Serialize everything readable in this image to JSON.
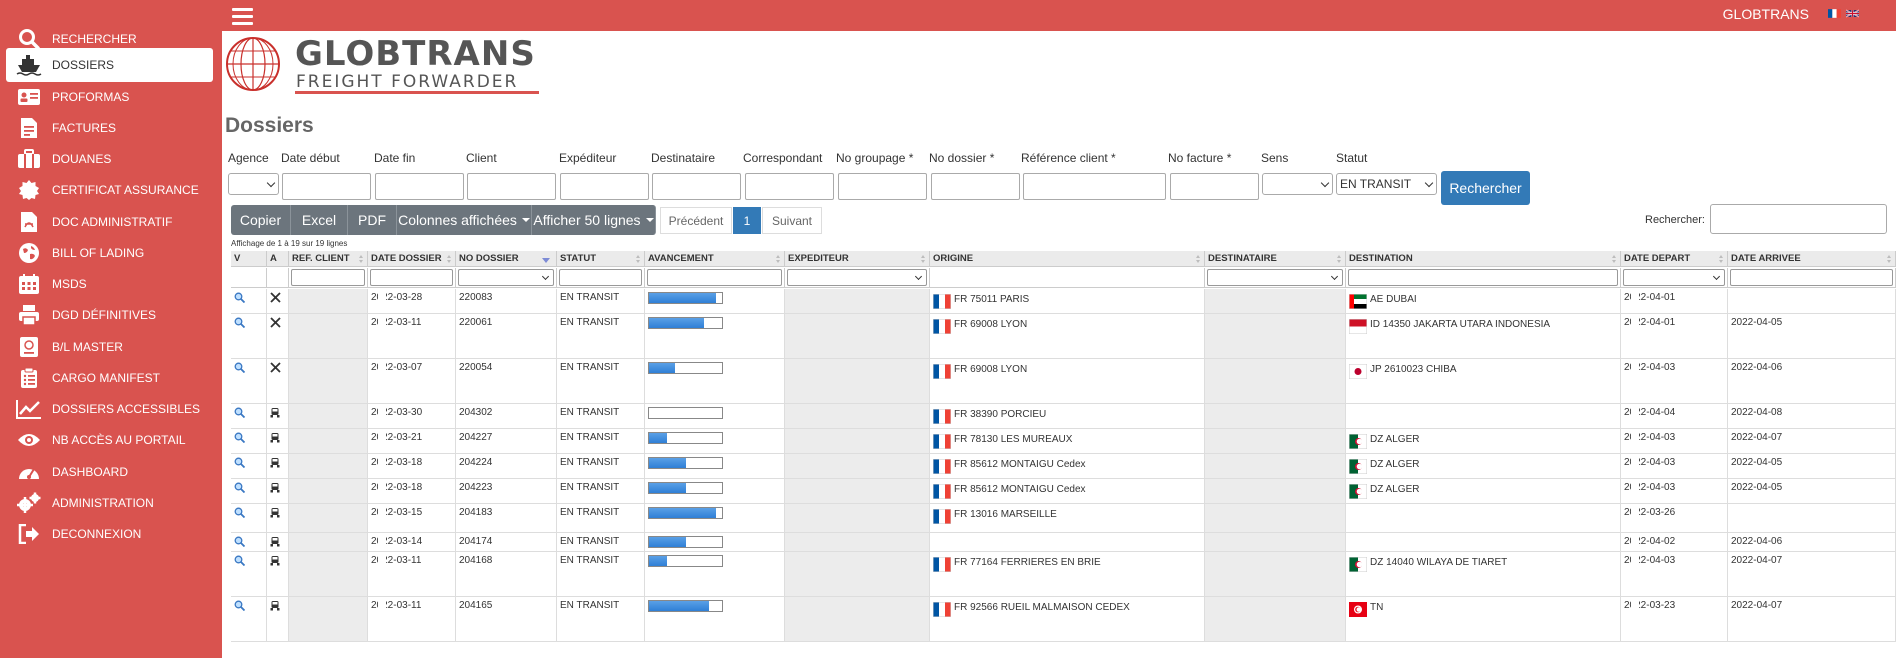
{
  "sidebar": {
    "items": [
      {
        "label": "RECHERCHER",
        "icon": "search-icon"
      },
      {
        "label": "DOSSIERS",
        "icon": "ship-icon",
        "active": true
      },
      {
        "label": "PROFORMAS",
        "icon": "id-card-icon"
      },
      {
        "label": "FACTURES",
        "icon": "invoice-icon"
      },
      {
        "label": "DOUANES",
        "icon": "briefcase-icon"
      },
      {
        "label": "CERTIFICAT ASSURANCE",
        "icon": "certificate-icon"
      },
      {
        "label": "DOC ADMINISTRATIF",
        "icon": "pdf-file-icon"
      },
      {
        "label": "BILL OF LADING",
        "icon": "globe-icon"
      },
      {
        "label": "MSDS",
        "icon": "calendar-icon"
      },
      {
        "label": "DGD DÉFINITIVES",
        "icon": "printer-icon"
      },
      {
        "label": "B/L MASTER",
        "icon": "book-icon"
      },
      {
        "label": "CARGO MANIFEST",
        "icon": "clipboard-list-icon"
      },
      {
        "label": "DOSSIERS ACCESSIBLES",
        "icon": "line-chart-icon"
      },
      {
        "label": "NB ACCÈS AU PORTAIL",
        "icon": "eye-icon"
      },
      {
        "label": "DASHBOARD",
        "icon": "gauge-icon"
      },
      {
        "label": "ADMINISTRATION",
        "icon": "gears-icon"
      },
      {
        "label": "DECONNEXION",
        "icon": "sign-out-icon"
      }
    ]
  },
  "topbar": {
    "brand": "GLOBTRANS",
    "languages": [
      "fr",
      "en"
    ]
  },
  "logo": {
    "name": "GLOBTRANS",
    "tagline": "FREIGHT FORWARDER"
  },
  "page_title": "Dossiers",
  "filters": {
    "labels": {
      "agence": "Agence",
      "date_debut": "Date début",
      "date_fin": "Date fin",
      "client": "Client",
      "expediteur": "Expéditeur",
      "destinataire": "Destinataire",
      "correspondant": "Correspondant",
      "no_groupage": "No groupage *",
      "no_dossier": "No dossier *",
      "reference_client": "Référence client *",
      "no_facture": "No facture *",
      "sens": "Sens",
      "statut": "Statut"
    },
    "statut_value": "EN TRANSIT",
    "search_button": "Rechercher"
  },
  "table_tools": {
    "buttons": [
      "Copier",
      "Excel",
      "PDF",
      "Colonnes affichées",
      "Afficher 50 lignes"
    ],
    "pagination": {
      "prev": "Précédent",
      "current": "1",
      "next": "Suivant"
    },
    "search_label": "Rechercher:",
    "info": "Affichage de 1 à 19 sur 19 lignes"
  },
  "columns": [
    "V",
    "A",
    "REF. CLIENT",
    "DATE DOSSIER",
    "NO DOSSIER",
    "STATUT",
    "AVANCEMENT",
    "EXPEDITEUR",
    "ORIGINE",
    "DESTINATAIRE",
    "DESTINATION",
    "DATE DEPART",
    "DATE ARRIVEE"
  ],
  "rows": [
    {
      "mode": "air",
      "date_dossier": "2022-03-28",
      "no_dossier": "220083",
      "statut": "EN TRANSIT",
      "progress": 0.92,
      "origine": "FR 75011 PARIS",
      "origin_flag": "fr",
      "destination": "AE DUBAI",
      "dest_flag": "ae",
      "date_depart": "2022-04-01",
      "date_arrivee": ""
    },
    {
      "mode": "air",
      "date_dossier": "2022-03-11",
      "no_dossier": "220061",
      "statut": "EN TRANSIT",
      "progress": 0.75,
      "origine": "FR 69008 LYON",
      "origin_flag": "fr",
      "destination": "ID 14350 JAKARTA UTARA INDONESIA",
      "dest_flag": "id",
      "date_depart": "2022-04-01",
      "date_arrivee": "2022-04-05"
    },
    {
      "mode": "air",
      "date_dossier": "2022-03-07",
      "no_dossier": "220054",
      "statut": "EN TRANSIT",
      "progress": 0.35,
      "origine": "FR 69008 LYON",
      "origin_flag": "fr",
      "destination": "JP 2610023 CHIBA",
      "dest_flag": "jp",
      "date_depart": "2022-04-03",
      "date_arrivee": "2022-04-06"
    },
    {
      "mode": "truck",
      "date_dossier": "2022-03-30",
      "no_dossier": "204302",
      "statut": "EN TRANSIT",
      "progress": 0.0,
      "origine": "FR 38390 PORCIEU",
      "origin_flag": "fr",
      "destination": "",
      "dest_flag": "",
      "date_depart": "2022-04-04",
      "date_arrivee": "2022-04-08"
    },
    {
      "mode": "truck",
      "date_dossier": "2022-03-21",
      "no_dossier": "204227",
      "statut": "EN TRANSIT",
      "progress": 0.25,
      "origine": "FR 78130 LES MUREAUX",
      "origin_flag": "fr",
      "destination": "DZ ALGER",
      "dest_flag": "dz",
      "date_depart": "2022-04-03",
      "date_arrivee": "2022-04-07"
    },
    {
      "mode": "truck",
      "date_dossier": "2022-03-18",
      "no_dossier": "204224",
      "statut": "EN TRANSIT",
      "progress": 0.5,
      "origine": "FR 85612 MONTAIGU Cedex",
      "origin_flag": "fr",
      "destination": "DZ ALGER",
      "dest_flag": "dz",
      "date_depart": "2022-04-03",
      "date_arrivee": "2022-04-05"
    },
    {
      "mode": "truck",
      "date_dossier": "2022-03-18",
      "no_dossier": "204223",
      "statut": "EN TRANSIT",
      "progress": 0.5,
      "origine": "FR 85612 MONTAIGU Cedex",
      "origin_flag": "fr",
      "destination": "DZ ALGER",
      "dest_flag": "dz",
      "date_depart": "2022-04-03",
      "date_arrivee": "2022-04-05"
    },
    {
      "mode": "truck",
      "date_dossier": "2022-03-15",
      "no_dossier": "204183",
      "statut": "EN TRANSIT",
      "progress": 0.92,
      "origine": "FR 13016 MARSEILLE",
      "origin_flag": "fr",
      "destination": "",
      "dest_flag": "",
      "date_depart": "2022-03-26",
      "date_arrivee": ""
    },
    {
      "mode": "truck",
      "date_dossier": "2022-03-14",
      "no_dossier": "204174",
      "statut": "EN TRANSIT",
      "progress": 0.5,
      "origine": "",
      "origin_flag": "",
      "destination": "",
      "dest_flag": "",
      "date_depart": "2022-04-02",
      "date_arrivee": "2022-04-06"
    },
    {
      "mode": "truck",
      "date_dossier": "2022-03-11",
      "no_dossier": "204168",
      "statut": "EN TRANSIT",
      "progress": 0.25,
      "origine": "FR 77164 FERRIERES EN BRIE",
      "origin_flag": "fr",
      "destination": "DZ 14040 WILAYA DE TIARET",
      "dest_flag": "dz",
      "date_depart": "2022-04-03",
      "date_arrivee": "2022-04-07"
    },
    {
      "mode": "truck",
      "date_dossier": "2022-03-11",
      "no_dossier": "204165",
      "statut": "EN TRANSIT",
      "progress": 0.82,
      "origine": "FR 92566 RUEIL MALMAISON CEDEX",
      "origin_flag": "fr",
      "destination": "TN",
      "dest_flag": "tn",
      "date_depart": "2022-03-23",
      "date_arrivee": "2022-04-07"
    }
  ],
  "colors": {
    "sidebar": "#d9534f",
    "primary": "#337ab7",
    "toolbar_button": "#6c757d",
    "progress": "#2f7fd6"
  }
}
